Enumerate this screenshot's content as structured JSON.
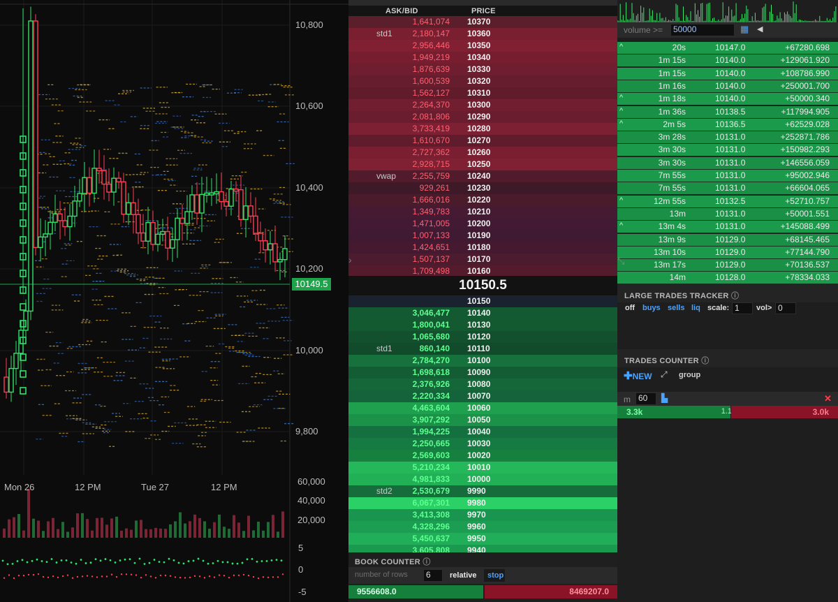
{
  "chart": {
    "price_axis": [
      "10,800",
      "10,600",
      "10,400",
      "10,200",
      "10,000",
      "9,800"
    ],
    "current_price_tag": "10149.5",
    "time_axis": [
      "Mon 26",
      "12 PM",
      "Tue 27",
      "12 PM"
    ],
    "volume_axis": [
      "60,000",
      "40,000",
      "20,000"
    ],
    "osc_axis": [
      "5",
      "0",
      "-5"
    ],
    "colors": {
      "up": "#2fe36a",
      "down": "#ff3c55",
      "bg": "#0c0c0c"
    }
  },
  "book": {
    "col_askbid": "ASK/BID",
    "col_price": "PRICE",
    "asks": [
      {
        "tag": "",
        "qty": "1,641,074",
        "price": "10370"
      },
      {
        "tag": "std1",
        "qty": "2,180,147",
        "price": "10360"
      },
      {
        "tag": "",
        "qty": "2,956,446",
        "price": "10350"
      },
      {
        "tag": "",
        "qty": "1,949,219",
        "price": "10340"
      },
      {
        "tag": "",
        "qty": "1,876,639",
        "price": "10330"
      },
      {
        "tag": "",
        "qty": "1,600,539",
        "price": "10320"
      },
      {
        "tag": "",
        "qty": "1,562,127",
        "price": "10310"
      },
      {
        "tag": "",
        "qty": "2,264,370",
        "price": "10300"
      },
      {
        "tag": "",
        "qty": "2,081,806",
        "price": "10290"
      },
      {
        "tag": "",
        "qty": "3,733,419",
        "price": "10280"
      },
      {
        "tag": "",
        "qty": "1,610,670",
        "price": "10270"
      },
      {
        "tag": "",
        "qty": "2,727,362",
        "price": "10260"
      },
      {
        "tag": "",
        "qty": "2,928,715",
        "price": "10250"
      },
      {
        "tag": "vwap",
        "qty": "2,255,759",
        "price": "10240"
      },
      {
        "tag": "",
        "qty": "929,261",
        "price": "10230"
      },
      {
        "tag": "",
        "qty": "1,666,016",
        "price": "10220"
      },
      {
        "tag": "",
        "qty": "1,349,783",
        "price": "10210"
      },
      {
        "tag": "",
        "qty": "1,471,005",
        "price": "10200"
      },
      {
        "tag": "",
        "qty": "1,007,133",
        "price": "10190"
      },
      {
        "tag": "",
        "qty": "1,424,651",
        "price": "10180"
      },
      {
        "tag": "",
        "qty": "1,507,137",
        "price": "10170"
      },
      {
        "tag": "",
        "qty": "1,709,498",
        "price": "10160"
      }
    ],
    "mid_price": "10150.5",
    "bids": [
      {
        "tag": "",
        "qty": "",
        "price": "10150"
      },
      {
        "tag": "",
        "qty": "3,046,477",
        "price": "10140"
      },
      {
        "tag": "",
        "qty": "1,800,041",
        "price": "10130"
      },
      {
        "tag": "",
        "qty": "1,065,680",
        "price": "10120"
      },
      {
        "tag": "std1",
        "qty": "860,140",
        "price": "10110"
      },
      {
        "tag": "",
        "qty": "2,784,270",
        "price": "10100"
      },
      {
        "tag": "",
        "qty": "1,698,618",
        "price": "10090"
      },
      {
        "tag": "",
        "qty": "2,376,926",
        "price": "10080"
      },
      {
        "tag": "",
        "qty": "2,220,334",
        "price": "10070"
      },
      {
        "tag": "",
        "qty": "4,463,604",
        "price": "10060"
      },
      {
        "tag": "",
        "qty": "3,907,292",
        "price": "10050"
      },
      {
        "tag": "",
        "qty": "1,994,225",
        "price": "10040"
      },
      {
        "tag": "",
        "qty": "2,250,665",
        "price": "10030"
      },
      {
        "tag": "",
        "qty": "2,569,603",
        "price": "10020"
      },
      {
        "tag": "",
        "qty": "5,210,234",
        "price": "10010"
      },
      {
        "tag": "",
        "qty": "4,981,833",
        "price": "10000"
      },
      {
        "tag": "std2",
        "qty": "2,530,679",
        "price": "9990"
      },
      {
        "tag": "",
        "qty": "6,067,301",
        "price": "9980"
      },
      {
        "tag": "",
        "qty": "3,413,308",
        "price": "9970"
      },
      {
        "tag": "",
        "qty": "4,328,296",
        "price": "9960"
      },
      {
        "tag": "",
        "qty": "5,450,637",
        "price": "9950"
      },
      {
        "tag": "",
        "qty": "3,605,808",
        "price": "9940"
      }
    ],
    "counter_title": "BOOK COUNTER",
    "rows_placeholder": "number of rows",
    "rows_value": "6",
    "relative_label": "relative",
    "stop_label": "stop",
    "total_bid": "9556608.0",
    "total_ask": "8469207.0"
  },
  "trades": {
    "volume_label": "volume >=",
    "volume_value": "50000",
    "rows": [
      {
        "up": true,
        "time": "20s",
        "price": "10147.0",
        "amount": "+67280.698"
      },
      {
        "up": false,
        "time": "1m 15s",
        "price": "10140.0",
        "amount": "+129061.920"
      },
      {
        "up": false,
        "time": "1m 15s",
        "price": "10140.0",
        "amount": "+108786.990"
      },
      {
        "up": false,
        "time": "1m 16s",
        "price": "10140.0",
        "amount": "+250001.700"
      },
      {
        "up": true,
        "time": "1m 18s",
        "price": "10140.0",
        "amount": "+50000.340"
      },
      {
        "up": true,
        "time": "1m 36s",
        "price": "10138.5",
        "amount": "+117994.905"
      },
      {
        "up": true,
        "time": "2m 5s",
        "price": "10136.5",
        "amount": "+62529.028"
      },
      {
        "up": false,
        "time": "3m 28s",
        "price": "10131.0",
        "amount": "+252871.786"
      },
      {
        "up": false,
        "time": "3m 30s",
        "price": "10131.0",
        "amount": "+150982.293"
      },
      {
        "up": false,
        "time": "3m 30s",
        "price": "10131.0",
        "amount": "+146556.059"
      },
      {
        "up": false,
        "time": "7m 55s",
        "price": "10131.0",
        "amount": "+95002.946"
      },
      {
        "up": false,
        "time": "7m 55s",
        "price": "10131.0",
        "amount": "+66604.065"
      },
      {
        "up": true,
        "time": "12m 55s",
        "price": "10132.5",
        "amount": "+52710.757"
      },
      {
        "up": false,
        "time": "13m",
        "price": "10131.0",
        "amount": "+50001.551"
      },
      {
        "up": true,
        "time": "13m 4s",
        "price": "10131.0",
        "amount": "+145088.499"
      },
      {
        "up": false,
        "time": "13m 9s",
        "price": "10129.0",
        "amount": "+68145.465"
      },
      {
        "up": false,
        "time": "13m 10s",
        "price": "10129.0",
        "amount": "+77144.790"
      },
      {
        "up": false,
        "time": "13m 17s",
        "price": "10129.0",
        "amount": "+70136.537"
      },
      {
        "up": false,
        "time": "14m",
        "price": "10128.0",
        "amount": "+78334.033"
      }
    ]
  },
  "large_trades": {
    "title": "LARGE TRADES TRACKER",
    "off": "off",
    "buys": "buys",
    "sells": "sells",
    "liq": "liq",
    "scale_label": "scale:",
    "scale_value": "1",
    "vol_label": "vol>",
    "vol_value": "0"
  },
  "trades_counter": {
    "title": "TRADES COUNTER",
    "new_label": "NEW",
    "group_label": "group",
    "m_label": "m",
    "m_value": "60",
    "buy_total": "3.3k",
    "ratio": "1.1",
    "sell_total": "3.0k"
  }
}
